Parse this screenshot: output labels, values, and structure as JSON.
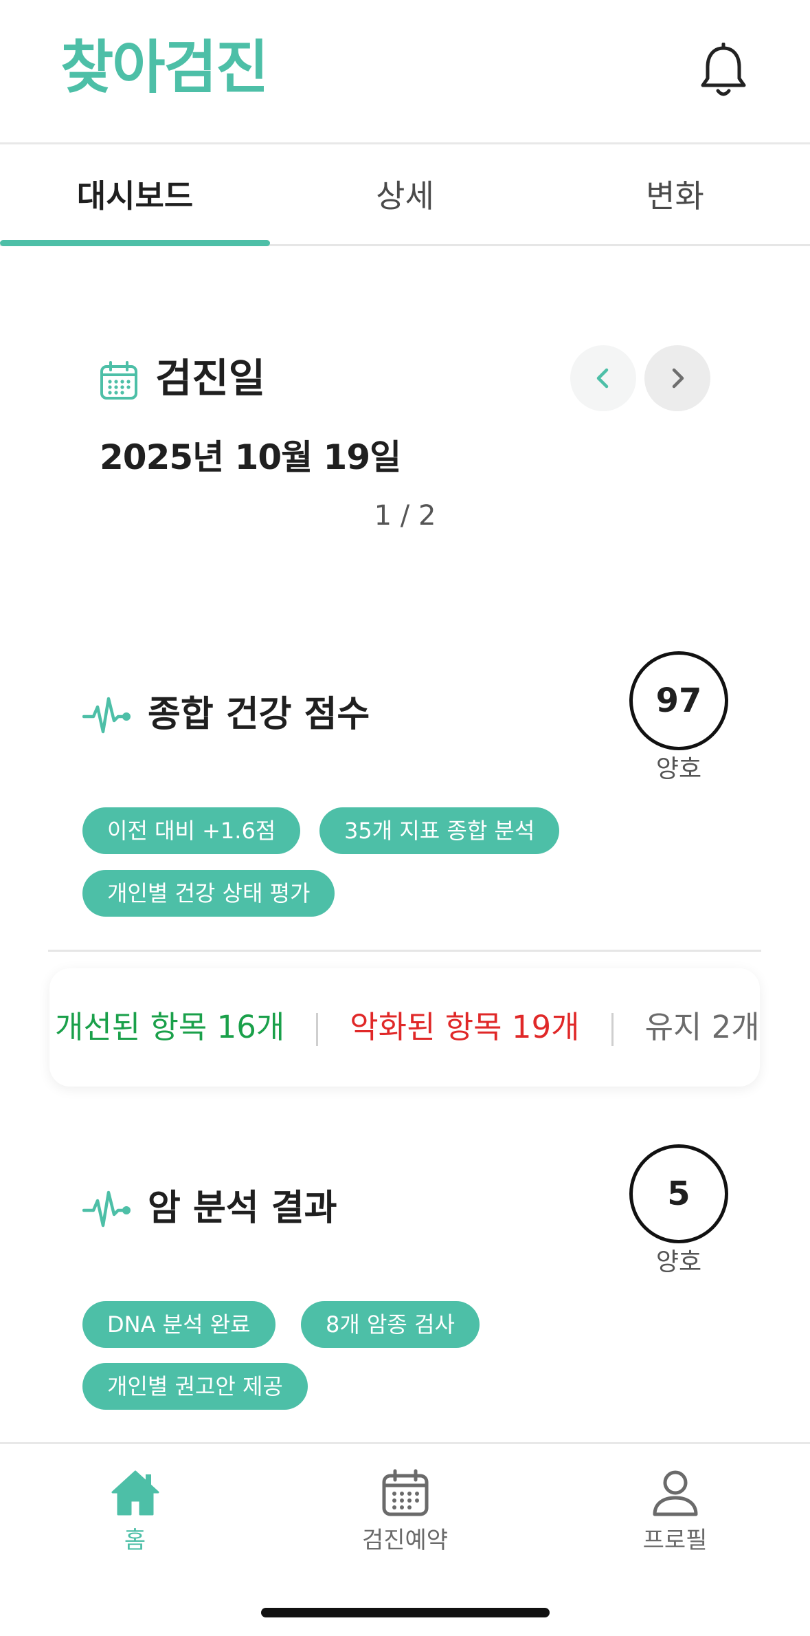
{
  "app": {
    "brand": "찾아검진"
  },
  "tabs": [
    {
      "label": "대시보드",
      "active": true
    },
    {
      "label": "상세",
      "active": false
    },
    {
      "label": "변화",
      "active": false
    }
  ],
  "date": {
    "title": "검진일",
    "value": "2025년 10월 19일",
    "pager": "1 / 2"
  },
  "health_score": {
    "title": "종합 건강 점수",
    "score": "97",
    "status": "양호",
    "chips": [
      "이전 대비 +1.6점",
      "35개 지표 종합 분석",
      "개인별 건강 상태 평가"
    ]
  },
  "summary": {
    "improved": "개선된 항목 16개",
    "worsened": "악화된 항목 19개",
    "kept": "유지 2개"
  },
  "cancer": {
    "title": "암 분석 결과",
    "score": "5",
    "status": "양호",
    "chips": [
      "DNA 분석 완료",
      "8개 암종 검사",
      "개인별 권고안 제공"
    ]
  },
  "bottom_nav": [
    {
      "label": "홈",
      "icon": "home-icon",
      "active": true
    },
    {
      "label": "검진예약",
      "icon": "calendar-icon",
      "active": false
    },
    {
      "label": "프로필",
      "icon": "person-icon",
      "active": false
    }
  ],
  "colors": {
    "accent": "#4dbfa7",
    "improved": "#1aa04a",
    "worsened": "#e02828"
  }
}
